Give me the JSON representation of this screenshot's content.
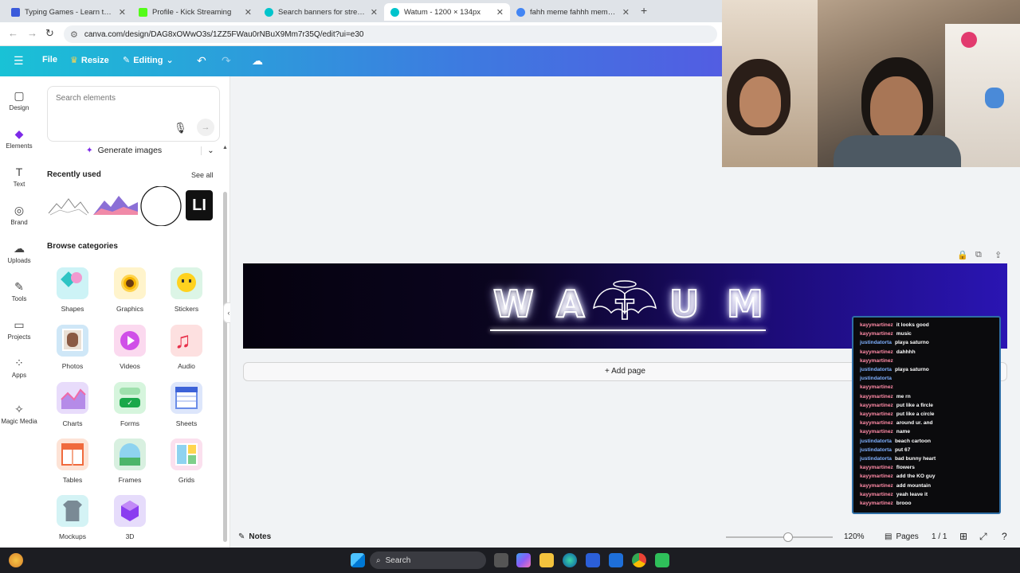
{
  "browser": {
    "tabs": [
      {
        "label": "Typing Games - Learn to Type",
        "color": "#3b5bdb"
      },
      {
        "label": "Profile - Kick Streaming",
        "color": "#53fc18"
      },
      {
        "label": "Search banners for streaming",
        "color": "#00c4cc"
      },
      {
        "label": "Watum - 1200 × 134px",
        "color": "#00c4cc"
      },
      {
        "label": "fahh meme fahhh meme - Goo",
        "color": "#4285f4"
      }
    ],
    "url": "canva.com/design/DAG8xOWwO3s/1ZZ5FWau0rNBuX9Mm7r35Q/edit?ui=e30"
  },
  "toolbar": {
    "file": "File",
    "resize": "Resize",
    "editing": "Editing"
  },
  "rail": [
    {
      "label": "Design",
      "icon": "design-icon",
      "glyph": "▢"
    },
    {
      "label": "Elements",
      "icon": "elements-icon",
      "glyph": "◆"
    },
    {
      "label": "Text",
      "icon": "text-icon",
      "glyph": "T"
    },
    {
      "label": "Brand",
      "icon": "brand-icon",
      "glyph": "◎"
    },
    {
      "label": "Uploads",
      "icon": "uploads-icon",
      "glyph": "☁"
    },
    {
      "label": "Tools",
      "icon": "tools-icon",
      "glyph": "✎"
    },
    {
      "label": "Projects",
      "icon": "projects-icon",
      "glyph": "▭"
    },
    {
      "label": "Apps",
      "icon": "apps-icon",
      "glyph": "⁘"
    },
    {
      "label": "Magic Media",
      "icon": "magic-media-icon",
      "glyph": "✧"
    }
  ],
  "panel": {
    "search_placeholder": "Search elements",
    "generate": "Generate images",
    "recently_used": "Recently used",
    "see_all": "See all",
    "browse": "Browse categories",
    "categories": [
      "Shapes",
      "Graphics",
      "Stickers",
      "Photos",
      "Videos",
      "Audio",
      "Charts",
      "Forms",
      "Sheets",
      "Tables",
      "Frames",
      "Grids",
      "Mockups",
      "3D"
    ]
  },
  "canvas": {
    "add_page": "+ Add page"
  },
  "bottom": {
    "notes": "Notes",
    "zoom": "120%",
    "pages": "Pages",
    "page_count": "1 / 1",
    "zoom_level": 0.58
  },
  "taskbar": {
    "search": "Search"
  },
  "chat": [
    {
      "user": "kayymartinez",
      "msg": "it looks good"
    },
    {
      "user": "kayymartinez",
      "msg": "music"
    },
    {
      "user": "justindatorta",
      "msg": "playa saturno"
    },
    {
      "user": "kayymartinez",
      "msg": "dahhhh"
    },
    {
      "user": "kayymartinez",
      "msg": ""
    },
    {
      "user": "justindatorta",
      "msg": "playa saturno"
    },
    {
      "user": "justindatorta",
      "msg": ""
    },
    {
      "user": "kayymartinez",
      "msg": ""
    },
    {
      "user": "kayymartinez",
      "msg": "me rn"
    },
    {
      "user": "kayymartinez",
      "msg": "put like a fircle"
    },
    {
      "user": "kayymartinez",
      "msg": "put like a circle"
    },
    {
      "user": "kayymartinez",
      "msg": "around ur. and"
    },
    {
      "user": "kayymartinez",
      "msg": "name"
    },
    {
      "user": "justindatorta",
      "msg": "beach cartoon"
    },
    {
      "user": "justindatorta",
      "msg": "put 67"
    },
    {
      "user": "justindatorta",
      "msg": "bad bunny heart"
    },
    {
      "user": "kayymartinez",
      "msg": "flowers"
    },
    {
      "user": "kayymartinez",
      "msg": "add the KO guy"
    },
    {
      "user": "kayymartinez",
      "msg": "add mountain"
    },
    {
      "user": "kayymartinez",
      "msg": "yeah leave it"
    },
    {
      "user": "kayymartinez",
      "msg": "brooo"
    }
  ],
  "colors": {
    "kayy": "#ff8aa6",
    "justin": "#7fb0ff",
    "accent": "#7d2ae8"
  }
}
